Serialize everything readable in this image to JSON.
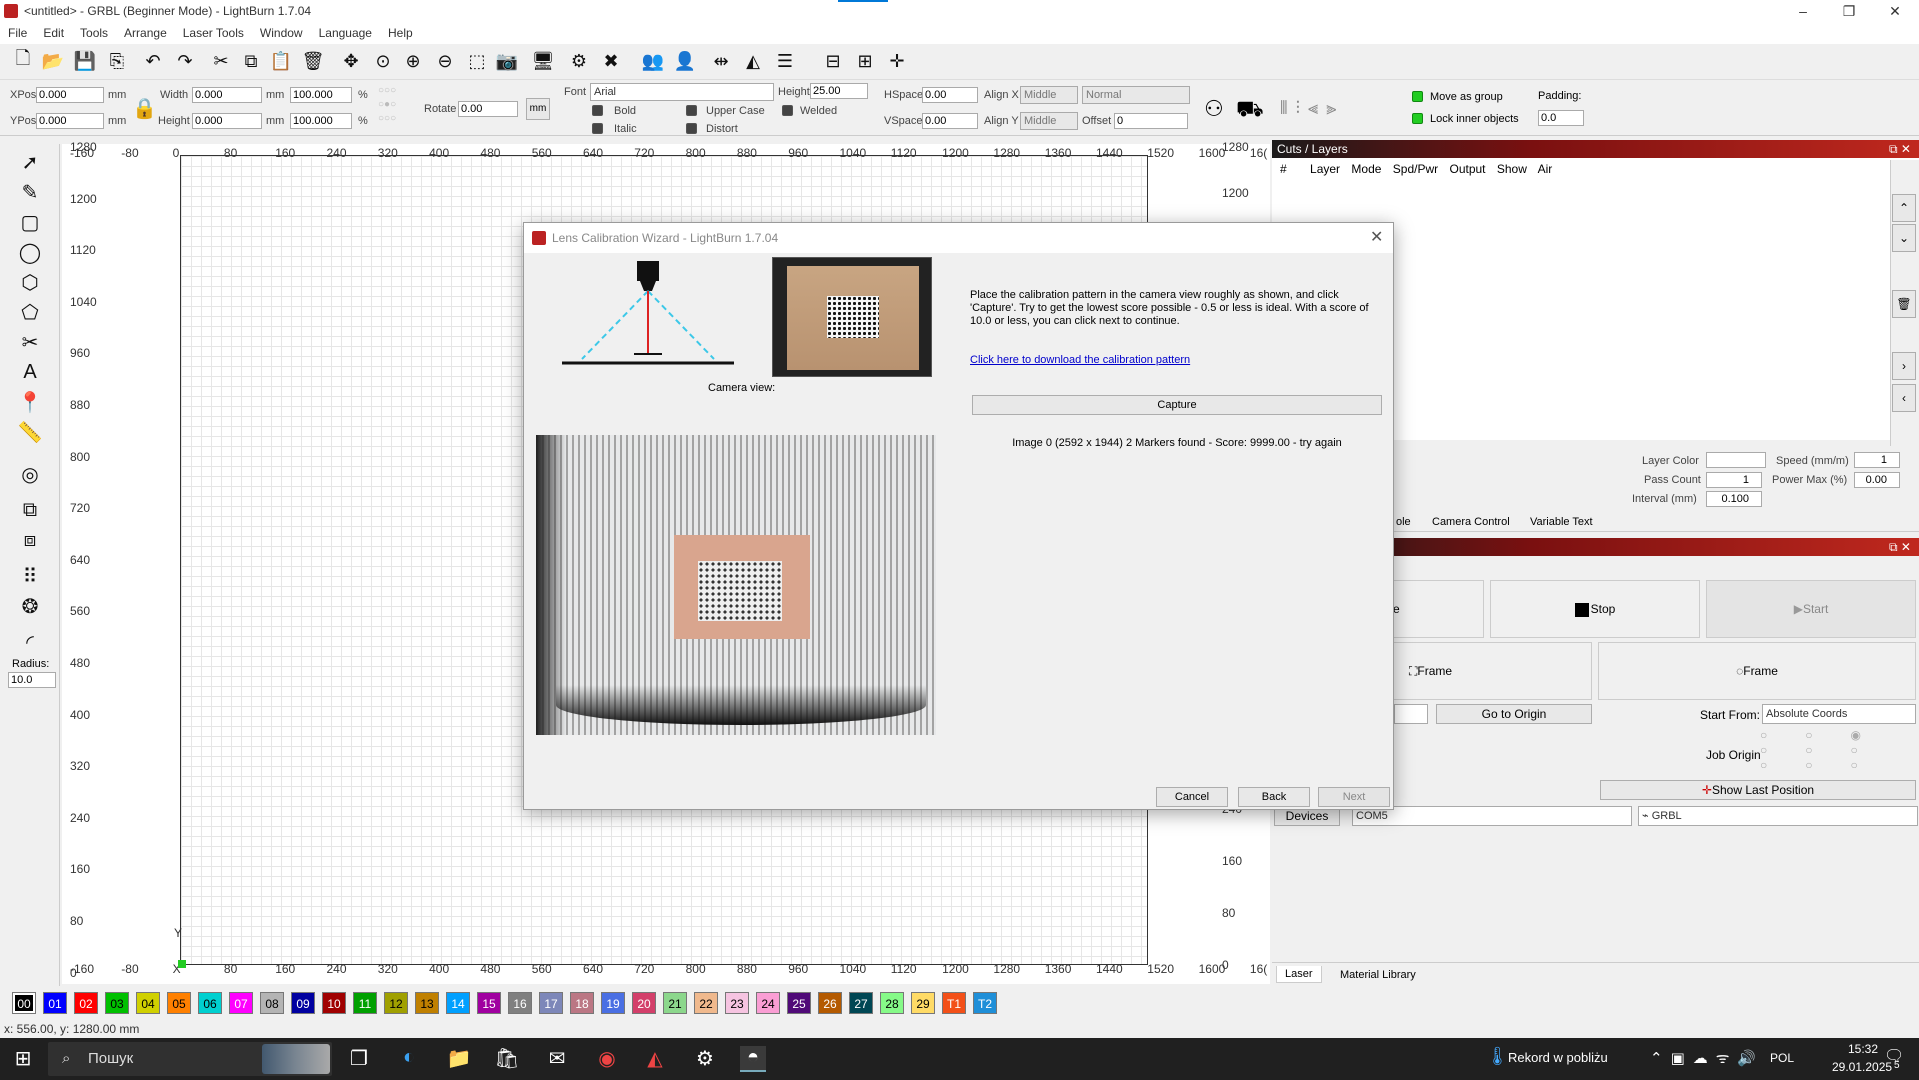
{
  "window": {
    "title": "<untitled> - GRBL (Beginner Mode) - LightBurn 1.7.04"
  },
  "menu": [
    "File",
    "Edit",
    "Tools",
    "Arrange",
    "Laser Tools",
    "Window",
    "Language",
    "Help"
  ],
  "props": {
    "xpos_label": "XPos",
    "xpos": "0.000",
    "ypos_label": "YPos",
    "ypos": "0.000",
    "unit_mm": "mm",
    "width_label": "Width",
    "width": "0.000",
    "height_label": "Height",
    "height": "0.000",
    "pct_w": "100.000",
    "pct_h": "100.000",
    "pct": "%",
    "rotate_label": "Rotate",
    "rotate": "0.00",
    "mm_button": "mm",
    "font_label": "Font",
    "font": "Arial",
    "fheight_label": "Height",
    "fheight": "25.00",
    "hspace_label": "HSpace",
    "hspace": "0.00",
    "vspace_label": "VSpace",
    "vspace": "0.00",
    "alignx_label": "Align X",
    "alignx": "Middle",
    "aligny_label": "Align Y",
    "aligny": "Middle",
    "normal": "Normal",
    "offset_label": "Offset",
    "offset": "0",
    "bold": "Bold",
    "italic": "Italic",
    "uppercase": "Upper Case",
    "distort": "Distort",
    "welded": "Welded",
    "move_as_group": "Move as group",
    "lock_inner": "Lock inner objects",
    "padding_label": "Padding:",
    "padding": "0.0"
  },
  "left_tools": {
    "radius_label": "Radius:",
    "radius": "10.0"
  },
  "ruler": {
    "top": [
      "-160",
      "-80",
      "0",
      "80",
      "160",
      "240",
      "320",
      "400",
      "480",
      "560",
      "640",
      "720",
      "800",
      "880",
      "960",
      "1040",
      "1120",
      "1200",
      "1280",
      "1360",
      "1440",
      "1520",
      "1600",
      "16("
    ],
    "bottom": [
      "-160",
      "-80",
      "X",
      "80",
      "160",
      "240",
      "320",
      "400",
      "480",
      "560",
      "640",
      "720",
      "800",
      "880",
      "960",
      "1040",
      "1120",
      "1200",
      "1280",
      "1360",
      "1440",
      "1520",
      "1600",
      "16("
    ],
    "left": [
      "1280",
      "1200",
      "1120",
      "1040",
      "960",
      "880",
      "800",
      "720",
      "640",
      "560",
      "480",
      "400",
      "320",
      "240",
      "160",
      "80",
      "0"
    ],
    "right": [
      "1280",
      "1200",
      "240",
      "160",
      "80",
      "0"
    ],
    "y_label": "Y"
  },
  "cuts": {
    "title": "Cuts / Layers",
    "columns": [
      "#",
      "Layer",
      "Mode",
      "Spd/Pwr",
      "Output",
      "Show",
      "Air"
    ],
    "layer_color_label": "Layer Color",
    "pass_count_label": "Pass Count",
    "pass_count": "1",
    "interval_label": "Interval (mm)",
    "interval": "0.100",
    "speed_label": "Speed (mm/m)",
    "speed": "1",
    "power_label": "Power Max (%)",
    "power": "0.00"
  },
  "tabs_mid": [
    "ole",
    "Camera Control",
    "Variable Text"
  ],
  "laser": {
    "btn_left_partial": "e",
    "stop": "Stop",
    "start": "Start",
    "frame1": "Frame",
    "frame2": "Frame",
    "go_origin": "Go to Origin",
    "start_from_label": "Start From:",
    "start_from": "Absolute Coords",
    "job_origin_label": "Job Origin",
    "show_last": "Show Last Position",
    "devices": "Devices",
    "port": "COM5",
    "device": "GRBL"
  },
  "bottom_tabs": [
    "Laser",
    "Material Library"
  ],
  "palette": [
    {
      "label": "00",
      "bg": "#000000",
      "fg": "#ffffff"
    },
    {
      "label": "01",
      "bg": "#0000ff",
      "fg": "#ffffff"
    },
    {
      "label": "02",
      "bg": "#ff0000",
      "fg": "#ffffff"
    },
    {
      "label": "03",
      "bg": "#00c000",
      "fg": "#000000"
    },
    {
      "label": "04",
      "bg": "#d0d000",
      "fg": "#000000"
    },
    {
      "label": "05",
      "bg": "#ff8000",
      "fg": "#000000"
    },
    {
      "label": "06",
      "bg": "#00d0d0",
      "fg": "#000000"
    },
    {
      "label": "07",
      "bg": "#ff00ff",
      "fg": "#ffffff"
    },
    {
      "label": "08",
      "bg": "#b4b4b4",
      "fg": "#000000"
    },
    {
      "label": "09",
      "bg": "#0000a0",
      "fg": "#ffffff"
    },
    {
      "label": "10",
      "bg": "#a00000",
      "fg": "#ffffff"
    },
    {
      "label": "11",
      "bg": "#00a000",
      "fg": "#ffffff"
    },
    {
      "label": "12",
      "bg": "#a0a000",
      "fg": "#000000"
    },
    {
      "label": "13",
      "bg": "#c08000",
      "fg": "#000000"
    },
    {
      "label": "14",
      "bg": "#00a0ff",
      "fg": "#ffffff"
    },
    {
      "label": "15",
      "bg": "#a000a0",
      "fg": "#ffffff"
    },
    {
      "label": "16",
      "bg": "#808080",
      "fg": "#ffffff"
    },
    {
      "label": "17",
      "bg": "#7d87b9",
      "fg": "#ffffff"
    },
    {
      "label": "18",
      "bg": "#bb7784",
      "fg": "#ffffff"
    },
    {
      "label": "19",
      "bg": "#4a6fe3",
      "fg": "#ffffff"
    },
    {
      "label": "20",
      "bg": "#d33f6a",
      "fg": "#ffffff"
    },
    {
      "label": "21",
      "bg": "#8cd78c",
      "fg": "#000000"
    },
    {
      "label": "22",
      "bg": "#f0b98d",
      "fg": "#000000"
    },
    {
      "label": "23",
      "bg": "#f6c4e1",
      "fg": "#000000"
    },
    {
      "label": "24",
      "bg": "#fa9ed4",
      "fg": "#000000"
    },
    {
      "label": "25",
      "bg": "#500a78",
      "fg": "#ffffff"
    },
    {
      "label": "26",
      "bg": "#b45a00",
      "fg": "#ffffff"
    },
    {
      "label": "27",
      "bg": "#004754",
      "fg": "#ffffff"
    },
    {
      "label": "28",
      "bg": "#86fa88",
      "fg": "#000000"
    },
    {
      "label": "29",
      "bg": "#ffdb66",
      "fg": "#000000"
    },
    {
      "label": "T1",
      "bg": "#f35018",
      "fg": "#ffffff"
    },
    {
      "label": "T2",
      "bg": "#1f8fd8",
      "fg": "#ffffff"
    }
  ],
  "status": {
    "coords": "x: 556.00, y: 1280.00 mm"
  },
  "taskbar": {
    "search": "Пошук",
    "weather": "Rekord w pobliżu",
    "lang": "POL",
    "time": "15:32",
    "date": "29.01.2025",
    "notif": "5"
  },
  "dialog": {
    "title": "Lens Calibration Wizard - LightBurn 1.7.04",
    "camera_view_label": "Camera view:",
    "instructions": "Place the calibration pattern in the camera view roughly as shown, and click 'Capture'. Try to get the lowest score possible - 0.5 or less is ideal.  With a score of 10.0 or less, you can click next to continue.",
    "download_link": "Click here to download the calibration pattern",
    "capture": "Capture",
    "result": "Image 0 (2592 x 1944) 2 Markers found - Score: 9999.00 - try again",
    "cancel": "Cancel",
    "back": "Back",
    "next": "Next"
  }
}
